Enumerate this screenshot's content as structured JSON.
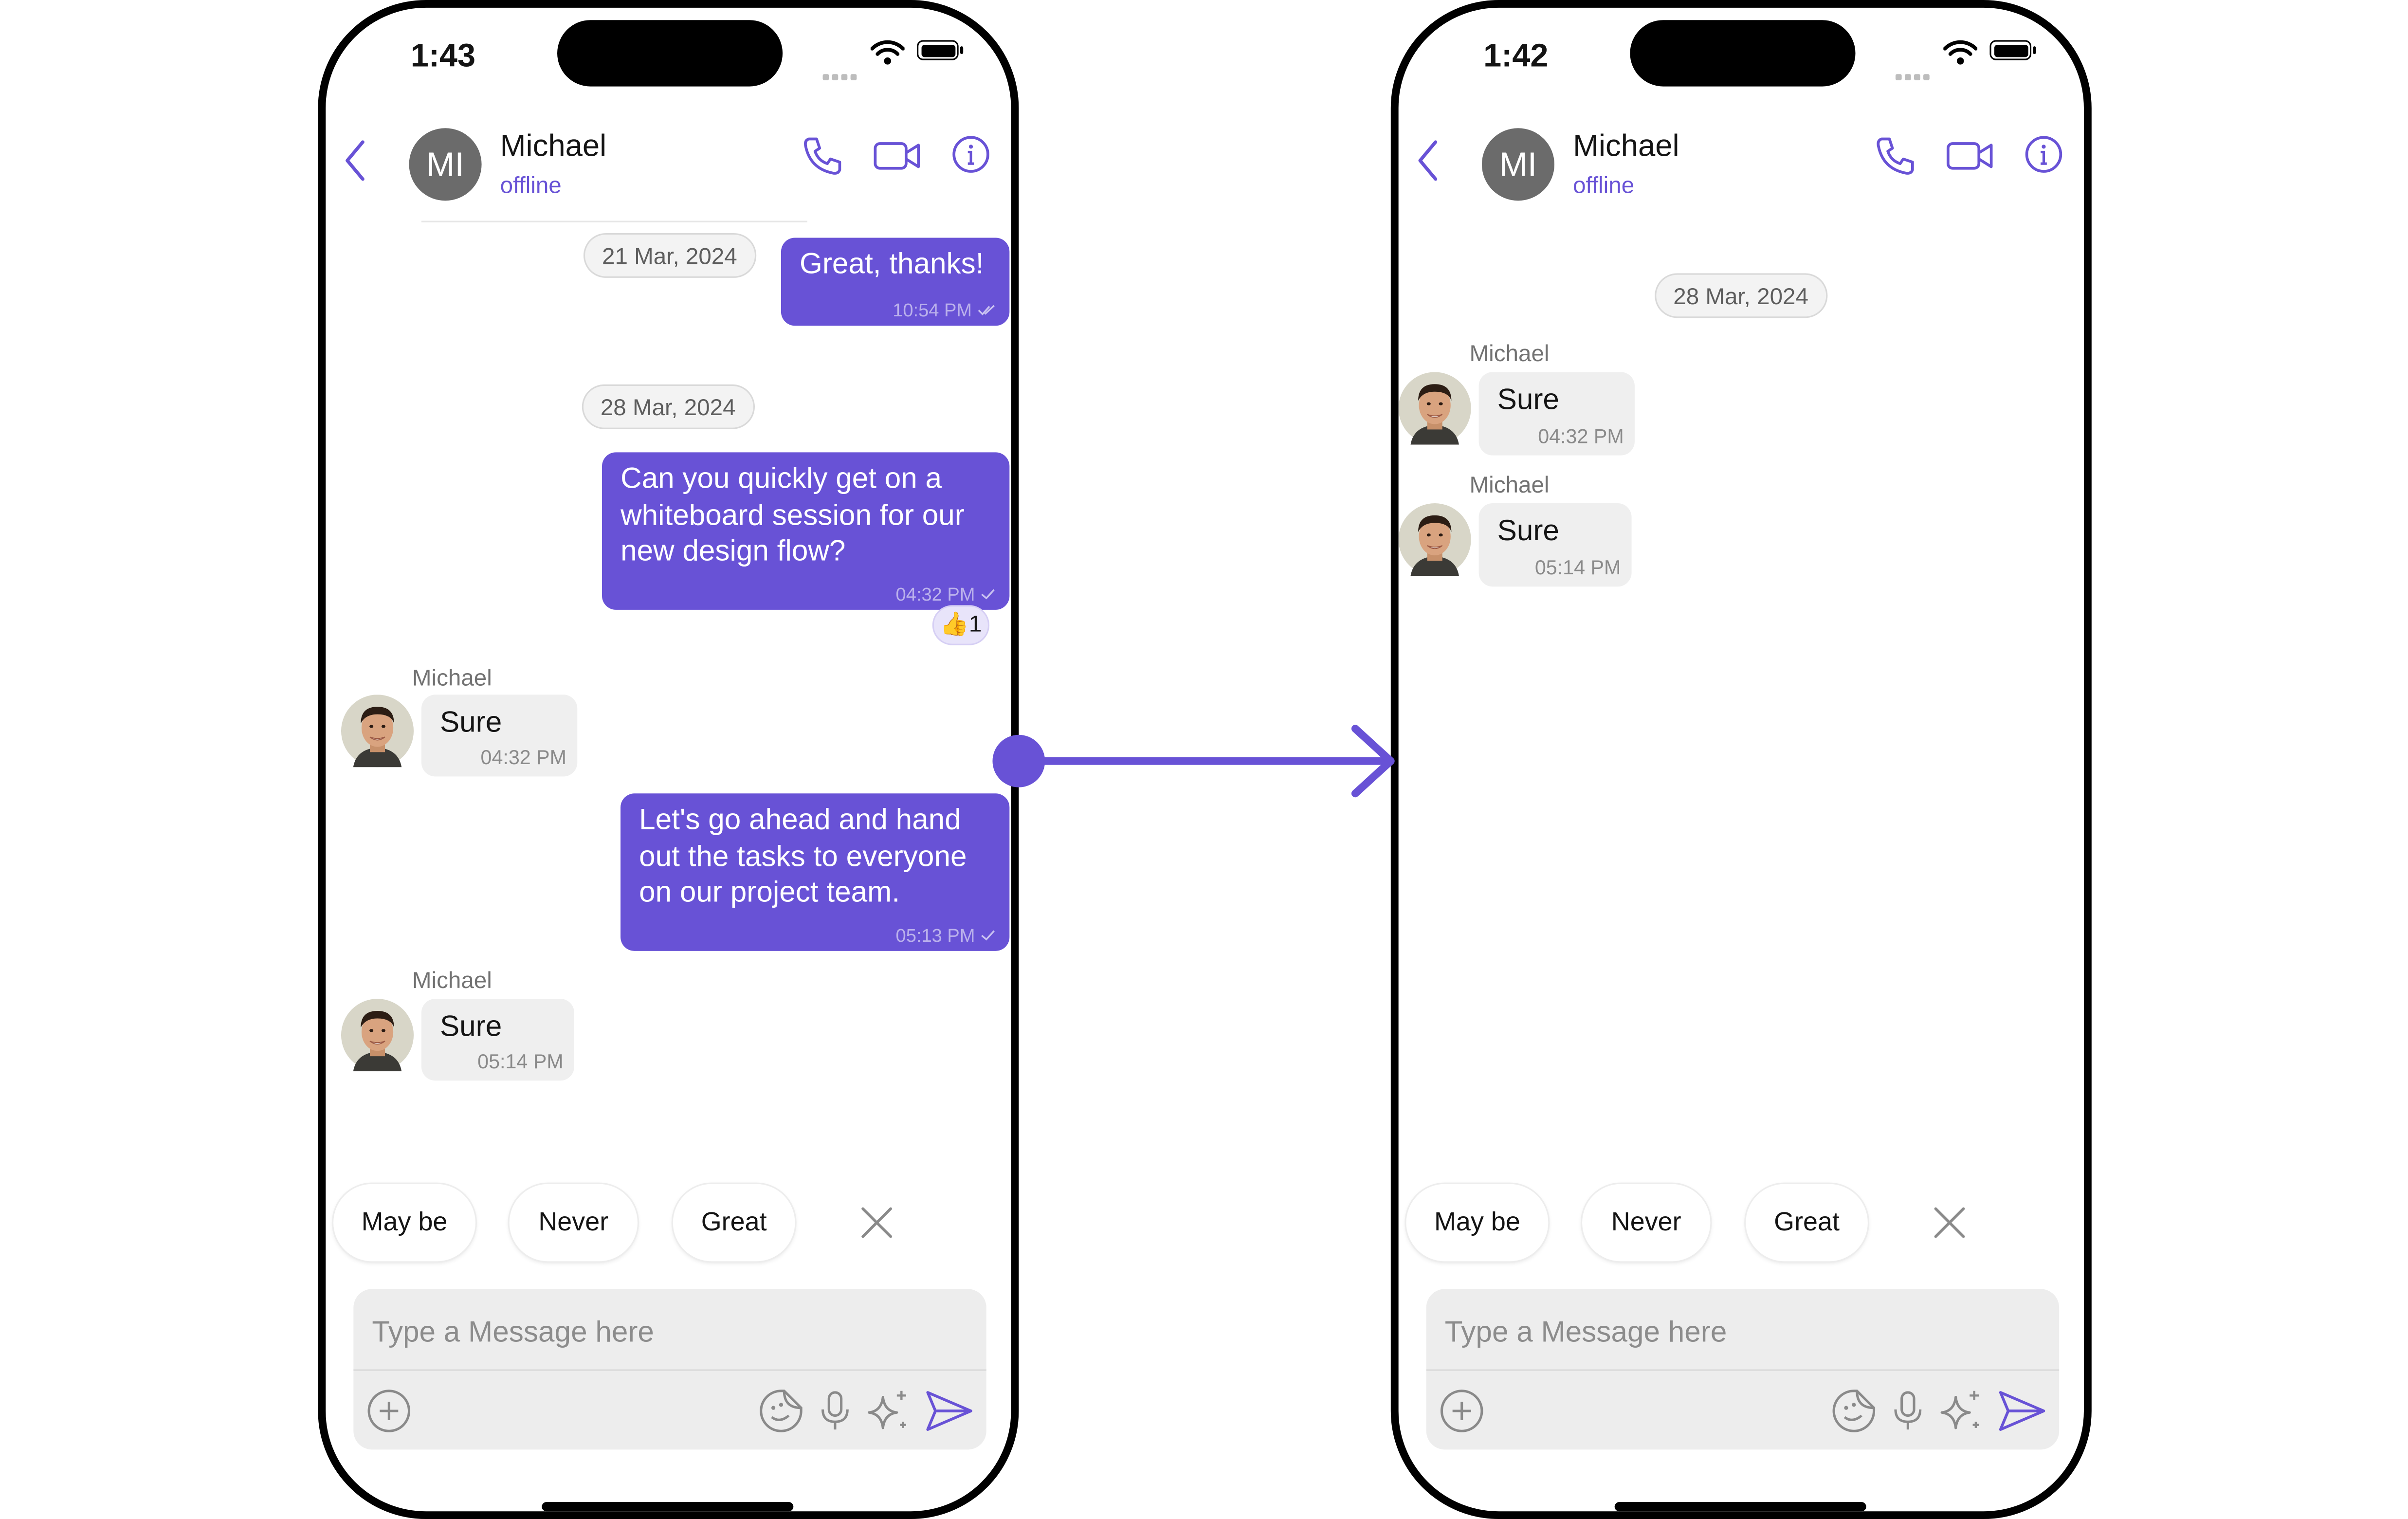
{
  "colors": {
    "accent": "#6852d6",
    "incoming_bubble": "#efefef",
    "meta_gray": "#8a8a8a"
  },
  "icons": [
    "back-chevron-icon",
    "voice-call-icon",
    "video-call-icon",
    "info-icon",
    "close-icon",
    "add-attachment-icon",
    "sticker-icon",
    "microphone-icon",
    "ai-sparkle-icon",
    "send-icon",
    "wifi-icon",
    "battery-icon",
    "double-check-icon",
    "single-check-icon"
  ],
  "left": {
    "time": "1:43",
    "header": {
      "avatar_initials": "MI",
      "name": "Michael",
      "status": "offline"
    },
    "messages": {
      "date1": "21 Mar, 2024",
      "m1": {
        "text": "Great, thanks!",
        "time": "10:54 PM"
      },
      "date2": "28 Mar, 2024",
      "m2": {
        "text": "Can you quickly get on a whiteboard session for our new design flow?",
        "time": "04:32 PM",
        "reaction_emoji": "👍",
        "reaction_count": "1"
      },
      "m3": {
        "sender": "Michael",
        "text": "Sure",
        "time": "04:32 PM"
      },
      "m4": {
        "text": "Let's go ahead and hand out the tasks to everyone on our project team.",
        "time": "05:13 PM"
      },
      "m5": {
        "sender": "Michael",
        "text": "Sure",
        "time": "05:14 PM"
      }
    },
    "smart_replies": [
      "May be",
      "Never",
      "Great"
    ],
    "composer": {
      "placeholder": "Type a Message here"
    }
  },
  "right": {
    "time": "1:42",
    "header": {
      "avatar_initials": "MI",
      "name": "Michael",
      "status": "offline"
    },
    "messages": {
      "date1": "28 Mar, 2024",
      "m1": {
        "sender": "Michael",
        "text": "Sure",
        "time": "04:32 PM"
      },
      "m2": {
        "sender": "Michael",
        "text": "Sure",
        "time": "05:14 PM"
      }
    },
    "smart_replies": [
      "May be",
      "Never",
      "Great"
    ],
    "composer": {
      "placeholder": "Type a Message here"
    }
  }
}
